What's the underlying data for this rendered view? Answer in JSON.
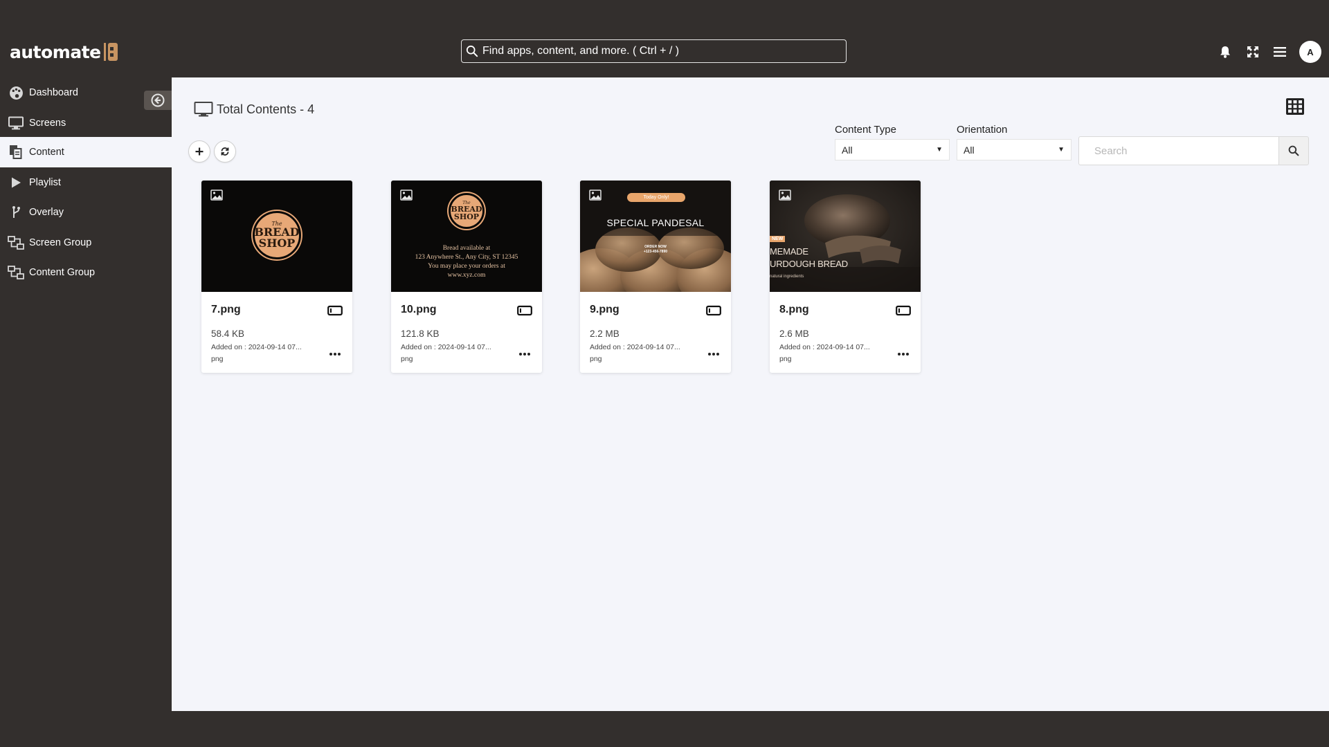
{
  "app": {
    "logo_text": "automate",
    "search_placeholder": "Find apps, content, and more. ( Ctrl + / )",
    "avatar_initial": "A"
  },
  "icons": {
    "notifications": "bell-icon",
    "fullscreen": "expand-icon",
    "menu": "hamburger-icon",
    "collapse": "arrow-left-circle-icon"
  },
  "colors": {
    "sidebar_bg": "#332f2d",
    "main_bg": "#f4f5fa",
    "brand_accent": "#c89562"
  },
  "sidebar": {
    "items": [
      {
        "label": "Dashboard",
        "icon": "palette-icon",
        "active": false
      },
      {
        "label": "Screens",
        "icon": "monitor-icon",
        "active": false
      },
      {
        "label": "Content",
        "icon": "copy-icon",
        "active": true
      },
      {
        "label": "Playlist",
        "icon": "play-icon",
        "active": false
      },
      {
        "label": "Overlay",
        "icon": "branch-icon",
        "active": false
      },
      {
        "label": "Screen Group",
        "icon": "group-icon",
        "active": false
      },
      {
        "label": "Content Group",
        "icon": "group-icon",
        "active": false
      }
    ]
  },
  "main": {
    "title": "Total Contents - 4",
    "filters": {
      "content_type": {
        "label": "Content Type",
        "value": "All"
      },
      "orientation": {
        "label": "Orientation",
        "value": "All"
      },
      "search_placeholder": "Search"
    },
    "cards": [
      {
        "name": "7.png",
        "size": "58.4 KB",
        "added": "Added on : 2024-09-14 07...",
        "ext": "png",
        "thumb": {
          "badge_the": "The",
          "badge_line1": "BREAD",
          "badge_line2": "SHOP"
        }
      },
      {
        "name": "10.png",
        "size": "121.8 KB",
        "added": "Added on : 2024-09-14 07...",
        "ext": "png",
        "thumb": {
          "badge_the": "The",
          "badge_line1": "BREAD",
          "badge_line2": "SHOP",
          "lines": [
            "Bread available at",
            "123 Anywhere St., Any City, ST 12345",
            "You may place your orders at",
            "www.xyz.com"
          ]
        }
      },
      {
        "name": "9.png",
        "size": "2.2 MB",
        "added": "Added on : 2024-09-14 07...",
        "ext": "png",
        "thumb": {
          "pill": "Today Only!",
          "title": "SPECIAL PANDESAL",
          "small1": "ORDER NOW",
          "small2": "+123-456-7890"
        }
      },
      {
        "name": "8.png",
        "size": "2.6 MB",
        "added": "Added on : 2024-09-14 07...",
        "ext": "png",
        "thumb": {
          "new": "NEW",
          "line1": "MEMADE",
          "line2": "URDOUGH BREAD",
          "small": "natural ingredients"
        }
      }
    ]
  }
}
